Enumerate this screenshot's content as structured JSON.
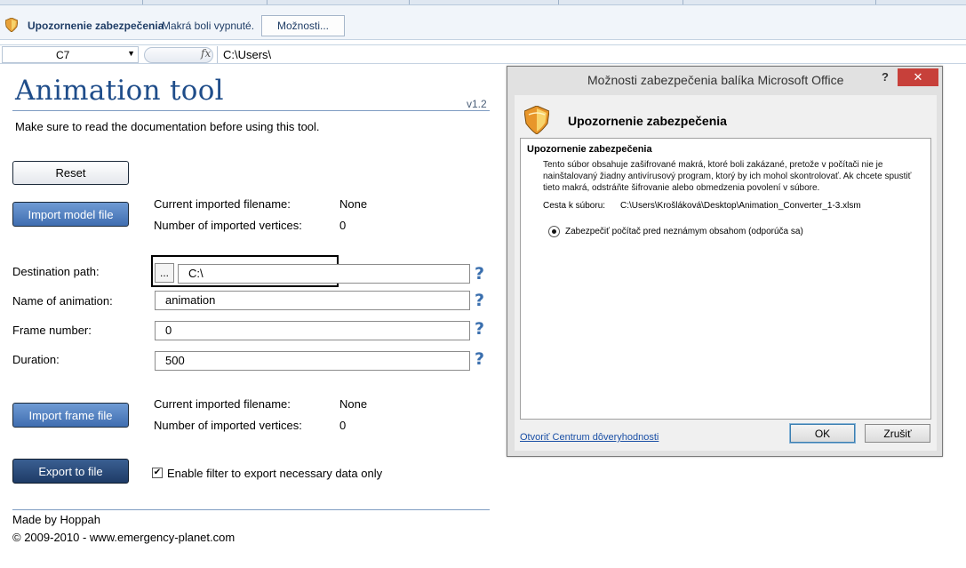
{
  "security_bar": {
    "title": "Upozornenie zabezpečenia",
    "message": "Makrá boli vypnuté.",
    "options_label": "Možnosti..."
  },
  "formula_bar": {
    "name_box": "C7",
    "fx_symbol": "fx",
    "value": "C:\\Users\\"
  },
  "sheet": {
    "title": "Animation tool",
    "version": "v1.2",
    "subtitle": "Make sure to read the documentation  before using  this tool.",
    "reset_label": "Reset",
    "import_model_label": "Import model file",
    "model_filename_label": "Current imported filename:",
    "model_filename_value": "None",
    "model_vertices_label": "Number of imported vertices:",
    "model_vertices_value": "0",
    "destination_label": "Destination path:",
    "browse_label": "...",
    "destination_value": "C:\\",
    "animation_name_label": "Name of animation:",
    "animation_name_value": "animation",
    "frame_label": "Frame number:",
    "frame_value": "0",
    "duration_label": "Duration:",
    "duration_value": "500",
    "help_symbol": "?",
    "import_frame_label": "Import frame file",
    "frame_filename_label": "Current imported filename:",
    "frame_filename_value": "None",
    "frame_vertices_label": "Number of imported vertices:",
    "frame_vertices_value": "0",
    "export_label": "Export to file",
    "filter_checked": true,
    "filter_label": "Enable filter to export necessary data only",
    "credit": "Made by Hoppah",
    "copyright": "© 2009-2010 - www.emergency-planet.com"
  },
  "dialog": {
    "title": "Možnosti zabezpečenia balíka Microsoft Office",
    "help_symbol": "?",
    "close_symbol": "✕",
    "heading": "Upozornenie zabezpečenia",
    "panel_title": "Upozornenie zabezpečenia",
    "paragraph": "Tento súbor obsahuje zašifrované makrá, ktoré boli zakázané, pretože v počítači nie je nainštalovaný žiadny antivírusový program, ktorý by ich mohol skontrolovať. Ak chcete spustiť tieto makrá, odstráňte šifrovanie alebo obmedzenia povolení v súbore.",
    "path_label": "Cesta k súboru:",
    "path_value": "C:\\Users\\Krošláková\\Desktop\\Animation_Converter_1-3.xlsm",
    "radio_label": "Zabezpečiť počítač pred neznámym obsahom (odporúča sa)",
    "trust_link": "Otvoriť Centrum dôveryhodnosti",
    "ok_label": "OK",
    "cancel_label": "Zrušiť"
  },
  "colors": {
    "accent_blue": "#3f6db0",
    "title_blue": "#1f4d8a",
    "close_red": "#c7403a",
    "link_blue": "#1a4fa5"
  }
}
